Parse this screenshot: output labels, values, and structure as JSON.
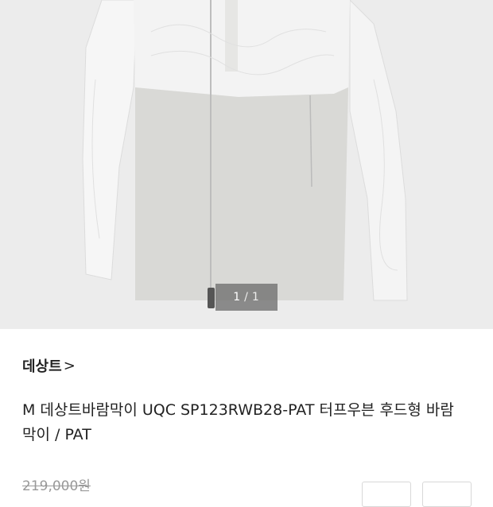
{
  "image_counter": {
    "current": "1",
    "separator": "/",
    "total": "1"
  },
  "brand": {
    "name": "데상트",
    "chevron": ">"
  },
  "product": {
    "title": "M 데상트바람막이 UQC SP123RWB28-PAT 터프우븐 후드형 바람막이 / PAT",
    "original_price": "219,000원"
  },
  "colors": {
    "image_bg": "#ececec",
    "counter_bg": "#6e6e6e",
    "text": "#222222",
    "strike_price": "#999999"
  },
  "icons": {
    "brand_link": "chevron-right-icon"
  }
}
